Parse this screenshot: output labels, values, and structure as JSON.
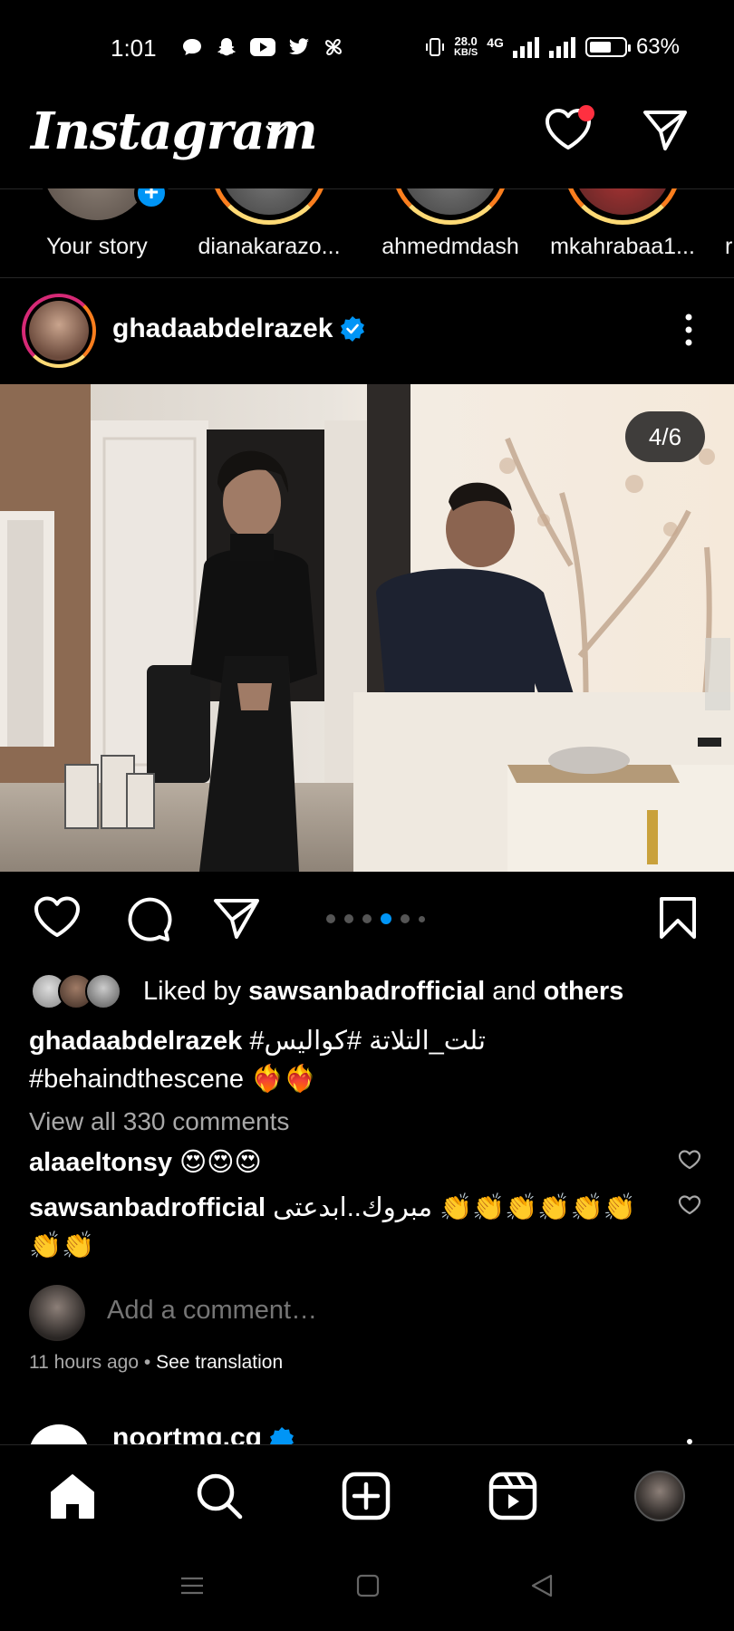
{
  "status_bar": {
    "time": "1:01",
    "speed_value": "28.0",
    "speed_unit": "KB/S",
    "network": "4G",
    "battery": "63%",
    "battery_level": 0.63,
    "app_icons": [
      "chat-bubble-icon",
      "snapchat-icon",
      "youtube-icon",
      "twitter-icon",
      "pinwheel-icon"
    ]
  },
  "top_bar": {
    "logo": "Instagram",
    "has_notification": true
  },
  "stories": [
    {
      "name": "Your story",
      "own": true
    },
    {
      "name": "dianakarazo..."
    },
    {
      "name": "ahmedmdash"
    },
    {
      "name": "mkahrabaa1..."
    },
    {
      "name": "r"
    }
  ],
  "post": {
    "username": "ghadaabdelrazek",
    "verified": true,
    "page_counter": "4/6",
    "carousel": {
      "count": 6,
      "active": 4
    },
    "liked_by_prefix": "Liked by ",
    "liked_by_user": "sawsanbadrofficial",
    "liked_by_and": " and ",
    "liked_by_others": "others",
    "caption_user": "ghadaabdelrazek",
    "caption_text": " #تلت_التلاتة #كواليس",
    "caption_line2": "#behaindthescene ❤️‍🔥❤️‍🔥",
    "view_all": "View all 330 comments",
    "comments": [
      {
        "user": "alaaeltonsy",
        "text": " 😍😍😍"
      },
      {
        "user": "sawsanbadrofficial",
        "text": " مبروك..ابدعتى 👏👏👏👏👏👏 👏👏"
      }
    ],
    "add_comment_placeholder": "Add a comment…",
    "time_ago": "11 hours ago",
    "separator": " • ",
    "see_translation": "See translation"
  },
  "next_post": {
    "username": "noortmg.cq"
  },
  "colors": {
    "accent_blue": "#0095f6",
    "notification_red": "#ff3040",
    "secondary_text": "#a8a8a8"
  }
}
